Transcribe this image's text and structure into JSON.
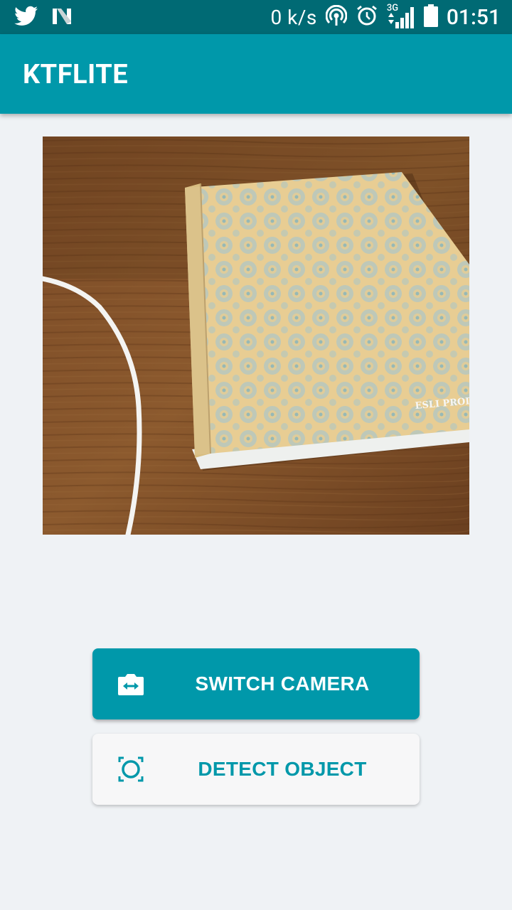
{
  "status_bar": {
    "net_speed": "0 k/s",
    "network_type": "3G",
    "time": "01:51",
    "icons": [
      "twitter-icon",
      "n-icon",
      "hotspot-icon",
      "alarm-icon",
      "signal-icon",
      "battery-icon"
    ]
  },
  "app_bar": {
    "title": "KTFLITE"
  },
  "preview": {
    "notebook_text": "ESLI PROD"
  },
  "buttons": {
    "switch_camera": "SWITCH CAMERA",
    "detect_object": "DETECT OBJECT"
  },
  "colors": {
    "primary": "#0098aa",
    "primary_dark": "#006a74",
    "background": "#eff2f5",
    "button_light": "#f7f7f8"
  }
}
